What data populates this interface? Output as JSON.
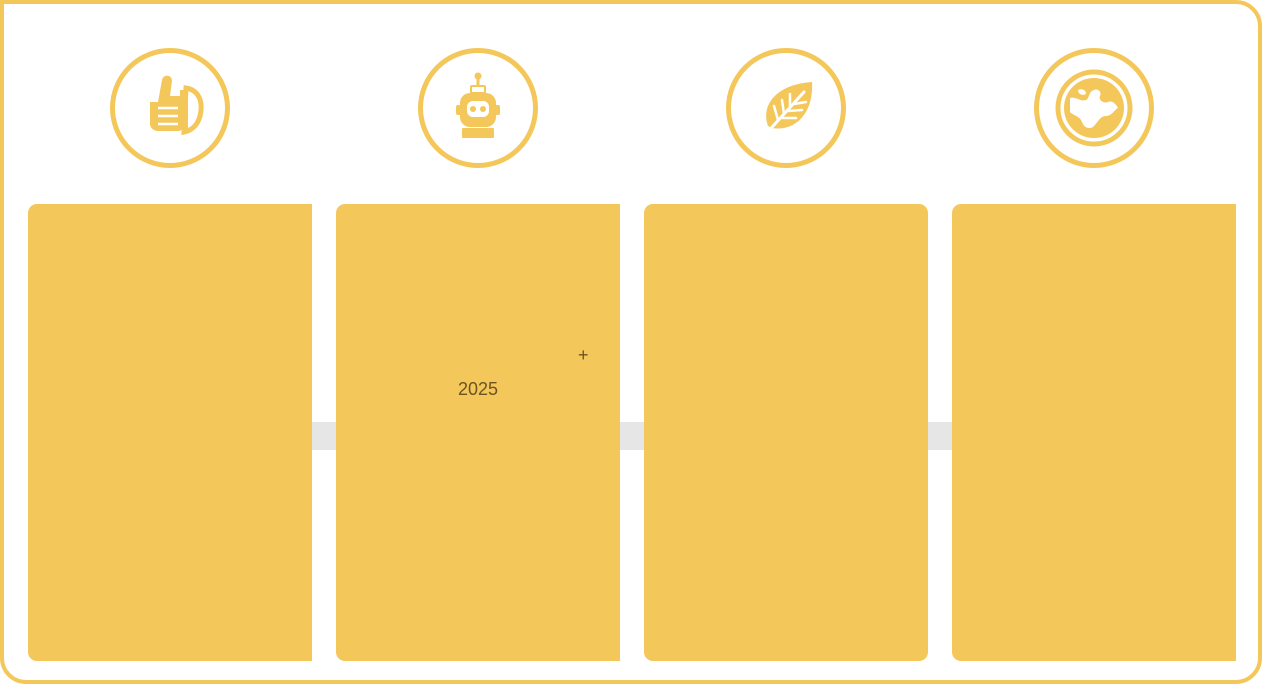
{
  "theme": {
    "accent": "#F4C75A",
    "connector": "#E6E6E6",
    "background": "#FFFFFF",
    "text": "#6B5420"
  },
  "columns": [
    {
      "icon": "thumbs-up-icon",
      "card_text": "",
      "marker": ""
    },
    {
      "icon": "robot-icon",
      "card_text": "2025",
      "marker": "+"
    },
    {
      "icon": "leaf-icon",
      "card_text": "",
      "marker": ""
    },
    {
      "icon": "globe-icon",
      "card_text": "",
      "marker": ""
    }
  ]
}
